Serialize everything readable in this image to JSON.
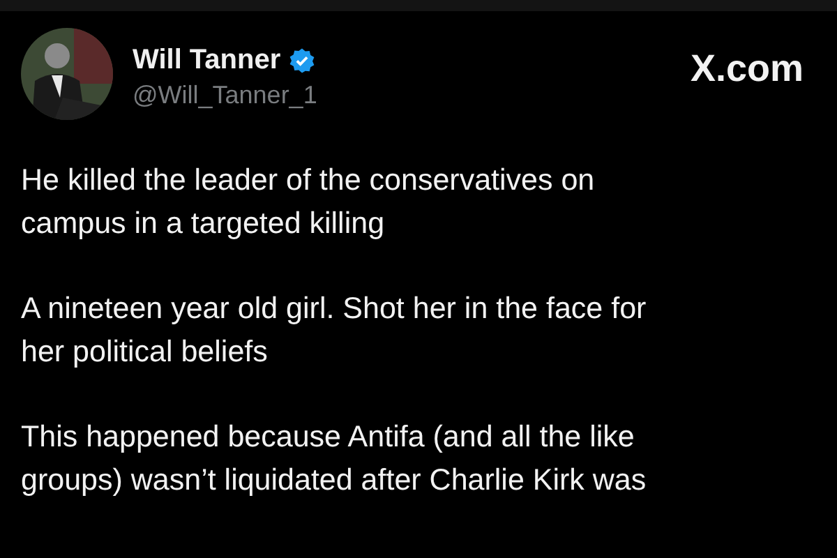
{
  "author": {
    "name": "Will Tanner",
    "verified": true,
    "handle": "@Will_Tanner_1"
  },
  "site": "X.com",
  "paragraphs": [
    {
      "lines": [
        "He killed the leader of the conservatives on",
        "campus in a targeted killing"
      ]
    },
    {
      "lines": [
        "A nineteen year old girl. Shot her in the face for",
        "her political beliefs"
      ]
    },
    {
      "lines": [
        "This happened because Antifa (and all the like",
        "groups) wasn’t liquidated after Charlie Kirk was"
      ]
    }
  ]
}
